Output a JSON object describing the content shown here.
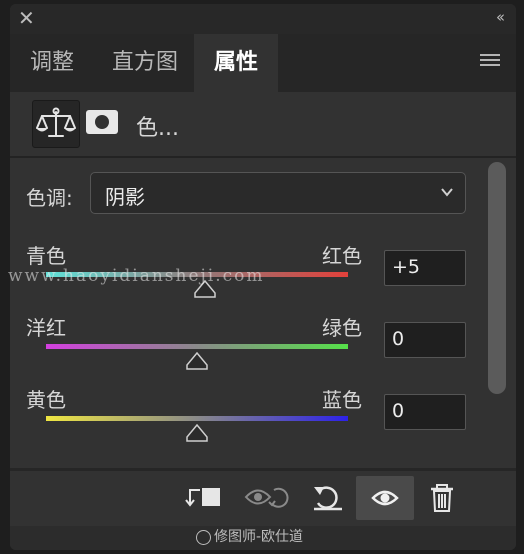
{
  "tabs": [
    {
      "label": "调整"
    },
    {
      "label": "直方图"
    },
    {
      "label": "属性",
      "active": true
    }
  ],
  "header": {
    "title": "色..."
  },
  "tone": {
    "label": "色调:",
    "value": "阴影"
  },
  "sliders": [
    {
      "left": "青色",
      "right": "红色",
      "value": "+5",
      "level_percent": 52.5,
      "gradient": [
        "#5fe3da",
        "#8f7a7a",
        "#e2413b"
      ]
    },
    {
      "left": "洋红",
      "right": "绿色",
      "value": "0",
      "level_percent": 50,
      "gradient": [
        "#d43fe0",
        "#8a8a8a",
        "#56e14a"
      ]
    },
    {
      "left": "黄色",
      "right": "蓝色",
      "value": "0",
      "level_percent": 50,
      "gradient": [
        "#efe642",
        "#8a8a8a",
        "#2d22e8"
      ]
    }
  ],
  "watermark": "www.haoyidiansheji.com",
  "credit": "修图师-欧仕道",
  "icons": {
    "close": "close-icon",
    "collapse": "collapse-icon",
    "menu": "panel-menu-icon",
    "balance": "balance-icon",
    "mask": "mask-icon",
    "clip": "clip-to-layer-icon",
    "view_previous": "view-previous-state-icon",
    "reset": "reset-icon",
    "visibility": "eye-icon",
    "delete": "trash-icon"
  }
}
